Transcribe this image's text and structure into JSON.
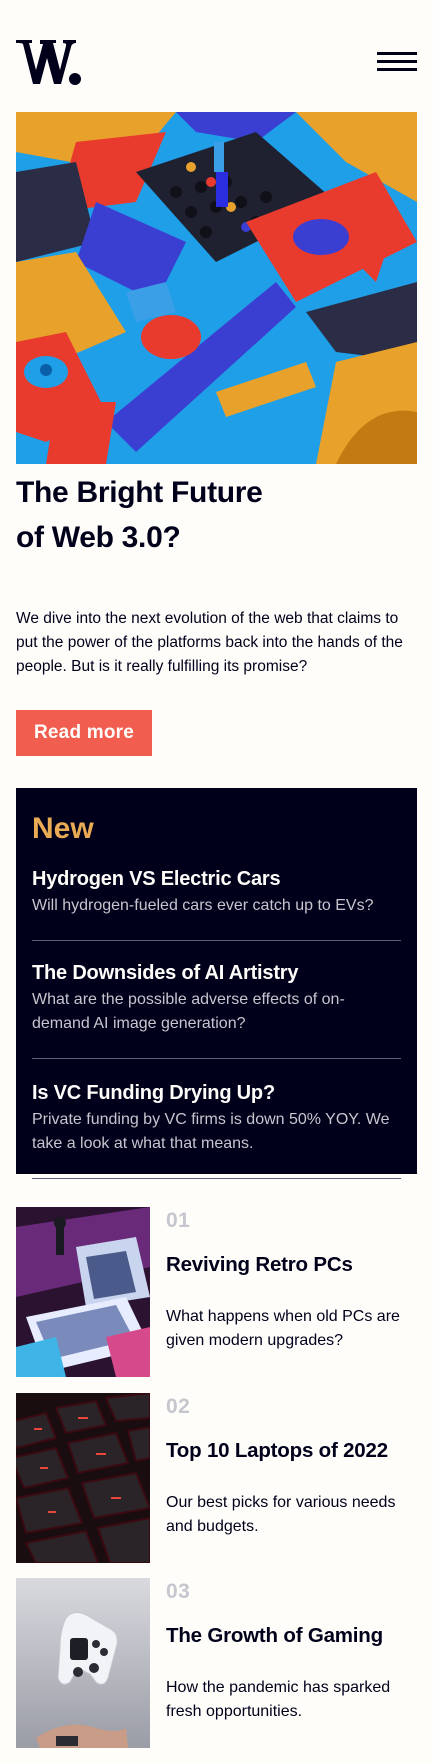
{
  "header": {
    "logo_icon": "w-logo-icon",
    "menu_icon": "hamburger-menu-icon"
  },
  "hero": {
    "image": "abstract-3d-blocks-image",
    "title": "The Bright Future of Web 3.0?",
    "description": "We dive into the next evolution of the web that claims to put the power of the platforms back into the hands of the people. But is it really fulfilling its promise?",
    "button_label": "Read more"
  },
  "new_section": {
    "heading": "New",
    "items": [
      {
        "title": "Hydrogen VS Electric Cars",
        "description": "Will hydrogen-fueled cars ever catch up to EVs?"
      },
      {
        "title": "The Downsides of AI Artistry",
        "description": "What are the possible adverse effects of on-demand AI image generation?"
      },
      {
        "title": "Is VC Funding Drying Up?",
        "description": "Private funding by VC firms is down 50% YOY. We take a look at what that means."
      }
    ]
  },
  "articles": [
    {
      "number": "01",
      "title": "Reviving Retro PCs",
      "description": "What happens when old PCs are given modern upgrades?",
      "image": "retro-pc-image"
    },
    {
      "number": "02",
      "title": "Top 10 Laptops of 2022",
      "description": "Our best picks for various needs and budgets.",
      "image": "laptop-keyboard-image"
    },
    {
      "number": "03",
      "title": "The Growth of Gaming",
      "description": "How the pandemic has sparked fresh opportunities.",
      "image": "game-controller-image"
    }
  ],
  "colors": {
    "background": "#fffdfa",
    "dark_navy": "#00001a",
    "soft_red": "#f15e50",
    "soft_orange": "#e9ab53",
    "grayish_blue": "#5d5f79",
    "light_gray": "#c5c6ce"
  }
}
